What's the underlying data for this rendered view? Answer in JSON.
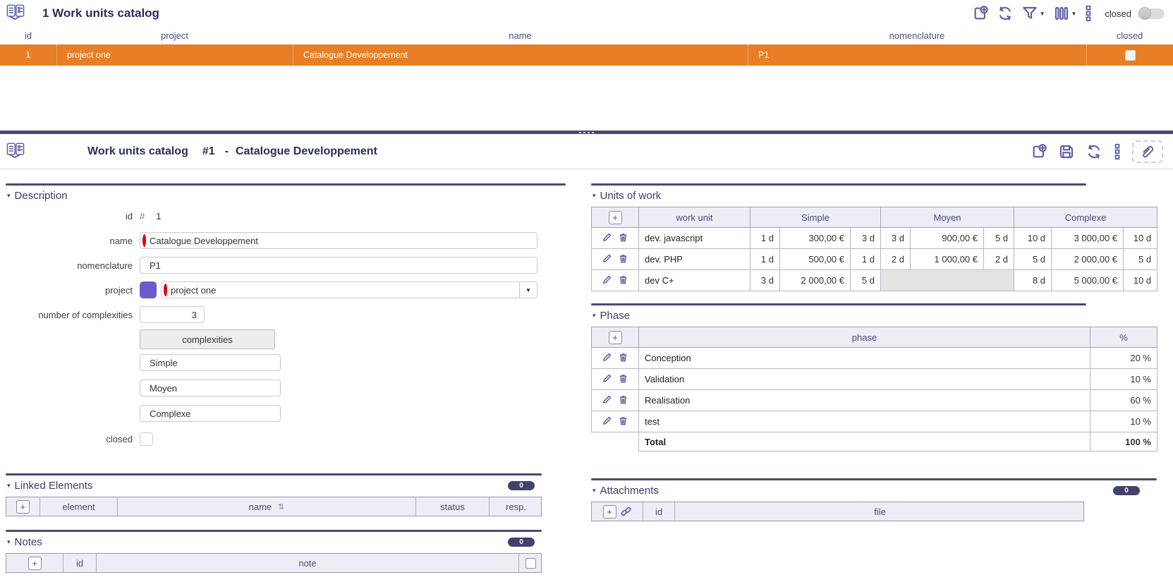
{
  "icons": {
    "add": "+",
    "collapse": "▾",
    "dropdown": "▼",
    "sort": "⇅"
  },
  "list_panel": {
    "title": "1 Work units catalog",
    "toolbar": {
      "closed_label": "closed"
    },
    "columns": {
      "id": "id",
      "project": "project",
      "name": "name",
      "nomenclature": "nomenclature",
      "closed": "closed"
    },
    "row": {
      "id": "1",
      "project": "project one",
      "name": "Catalogue Developpement",
      "nomenclature": "P1"
    }
  },
  "detail_panel": {
    "title": "Work units catalog",
    "record_id": "#1",
    "separator": "-",
    "record_name": "Catalogue Developpement",
    "description": {
      "heading": "Description",
      "id_label": "id",
      "id_hash": "#",
      "id_value": "1",
      "name_label": "name",
      "name_value": "Catalogue Developpement",
      "nomenclature_label": "nomenclature",
      "nomenclature_value": "P1",
      "project_label": "project",
      "project_value": "project one",
      "project_color": "#6B59CE",
      "num_complexities_label": "number of complexities",
      "num_complexities_value": "3",
      "complexities_header": "complexities",
      "complexities": [
        "Simple",
        "Moyen",
        "Complexe"
      ],
      "closed_label": "closed"
    },
    "units_of_work": {
      "heading": "Units of work",
      "col_work_unit": "work unit",
      "col_groups": [
        "Simple",
        "Moyen",
        "Complexe"
      ],
      "rows": [
        {
          "name": "dev. javascript",
          "simple": [
            "1 d",
            "300,00 €",
            "3 d"
          ],
          "moyen": [
            "3 d",
            "900,00 €",
            "5 d"
          ],
          "complexe": [
            "10 d",
            "3 000,00 €",
            "10 d"
          ]
        },
        {
          "name": "dev. PHP",
          "simple": [
            "1 d",
            "500,00 €",
            "1 d"
          ],
          "moyen": [
            "2 d",
            "1 000,00 €",
            "2 d"
          ],
          "complexe": [
            "5 d",
            "2 000,00 €",
            "5 d"
          ]
        },
        {
          "name": "dev C+",
          "simple": [
            "3 d",
            "2 000,00 €",
            "5 d"
          ],
          "moyen": null,
          "complexe": [
            "8 d",
            "5 000,00 €",
            "10 d"
          ]
        }
      ]
    },
    "phase": {
      "heading": "Phase",
      "col_phase": "phase",
      "col_pct": "%",
      "rows": [
        {
          "name": "Conception",
          "pct": "20 %"
        },
        {
          "name": "Validation",
          "pct": "10 %"
        },
        {
          "name": "Realisation",
          "pct": "60 %"
        },
        {
          "name": "test",
          "pct": "10 %"
        }
      ],
      "total_label": "Total",
      "total_pct": "100 %"
    },
    "linked_elements": {
      "heading": "Linked Elements",
      "badge": "0",
      "columns": {
        "element": "element",
        "name": "name",
        "status": "status",
        "resp": "resp."
      }
    },
    "attachments": {
      "heading": "Attachments",
      "badge": "0",
      "columns": {
        "id": "id",
        "file": "file"
      }
    },
    "notes": {
      "heading": "Notes",
      "badge": "0",
      "columns": {
        "id": "id",
        "note": "note"
      }
    }
  }
}
